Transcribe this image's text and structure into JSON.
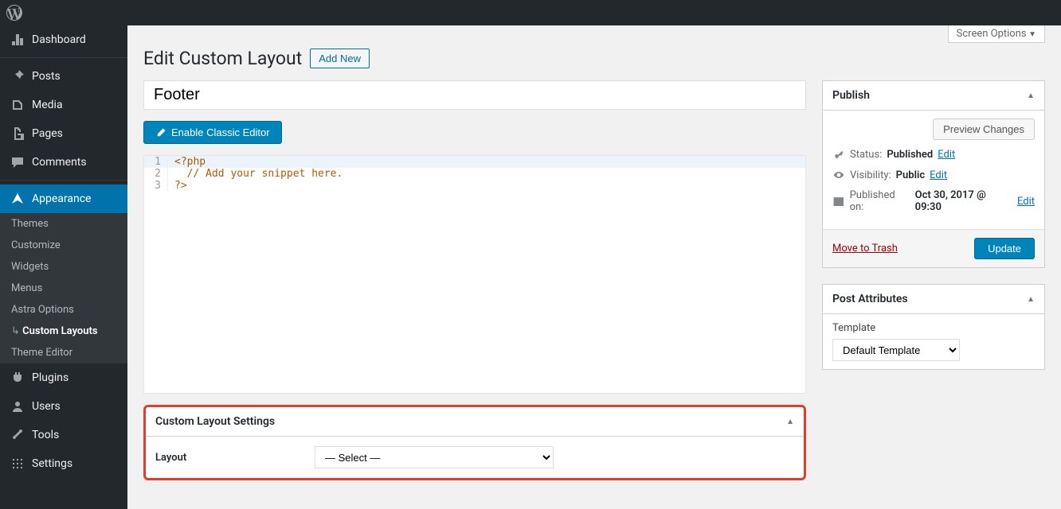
{
  "adminbar": {
    "logo": "wordpress"
  },
  "sidebar": {
    "items": [
      {
        "label": "Dashboard",
        "icon": "dashboard"
      },
      {
        "label": "Posts",
        "icon": "pin"
      },
      {
        "label": "Media",
        "icon": "media"
      },
      {
        "label": "Pages",
        "icon": "pages"
      },
      {
        "label": "Comments",
        "icon": "comments"
      },
      {
        "label": "Appearance",
        "icon": "appearance"
      },
      {
        "label": "Plugins",
        "icon": "plugins"
      },
      {
        "label": "Users",
        "icon": "users"
      },
      {
        "label": "Tools",
        "icon": "tools"
      },
      {
        "label": "Settings",
        "icon": "settings"
      }
    ],
    "submenu": [
      "Themes",
      "Customize",
      "Widgets",
      "Menus",
      "Astra Options",
      "Custom Layouts",
      "Theme Editor"
    ]
  },
  "header": {
    "screen_options": "Screen Options",
    "title": "Edit Custom Layout",
    "add_new": "Add New"
  },
  "title_value": "Footer",
  "classic_editor_btn": "Enable Classic Editor",
  "code": {
    "l1": "<?php",
    "l2": "// Add your snippet here.",
    "l3": "?>"
  },
  "custom_layout": {
    "box_title": "Custom Layout Settings",
    "field_label": "Layout",
    "select_value": "— Select —"
  },
  "publish": {
    "box_title": "Publish",
    "preview_btn": "Preview Changes",
    "status_label": "Status:",
    "status_value": "Published",
    "visibility_label": "Visibility:",
    "visibility_value": "Public",
    "published_label": "Published on:",
    "published_value": "Oct 30, 2017 @ 09:30",
    "edit": "Edit",
    "trash": "Move to Trash",
    "update": "Update"
  },
  "attributes": {
    "box_title": "Post Attributes",
    "template_label": "Template",
    "template_value": "Default Template"
  }
}
